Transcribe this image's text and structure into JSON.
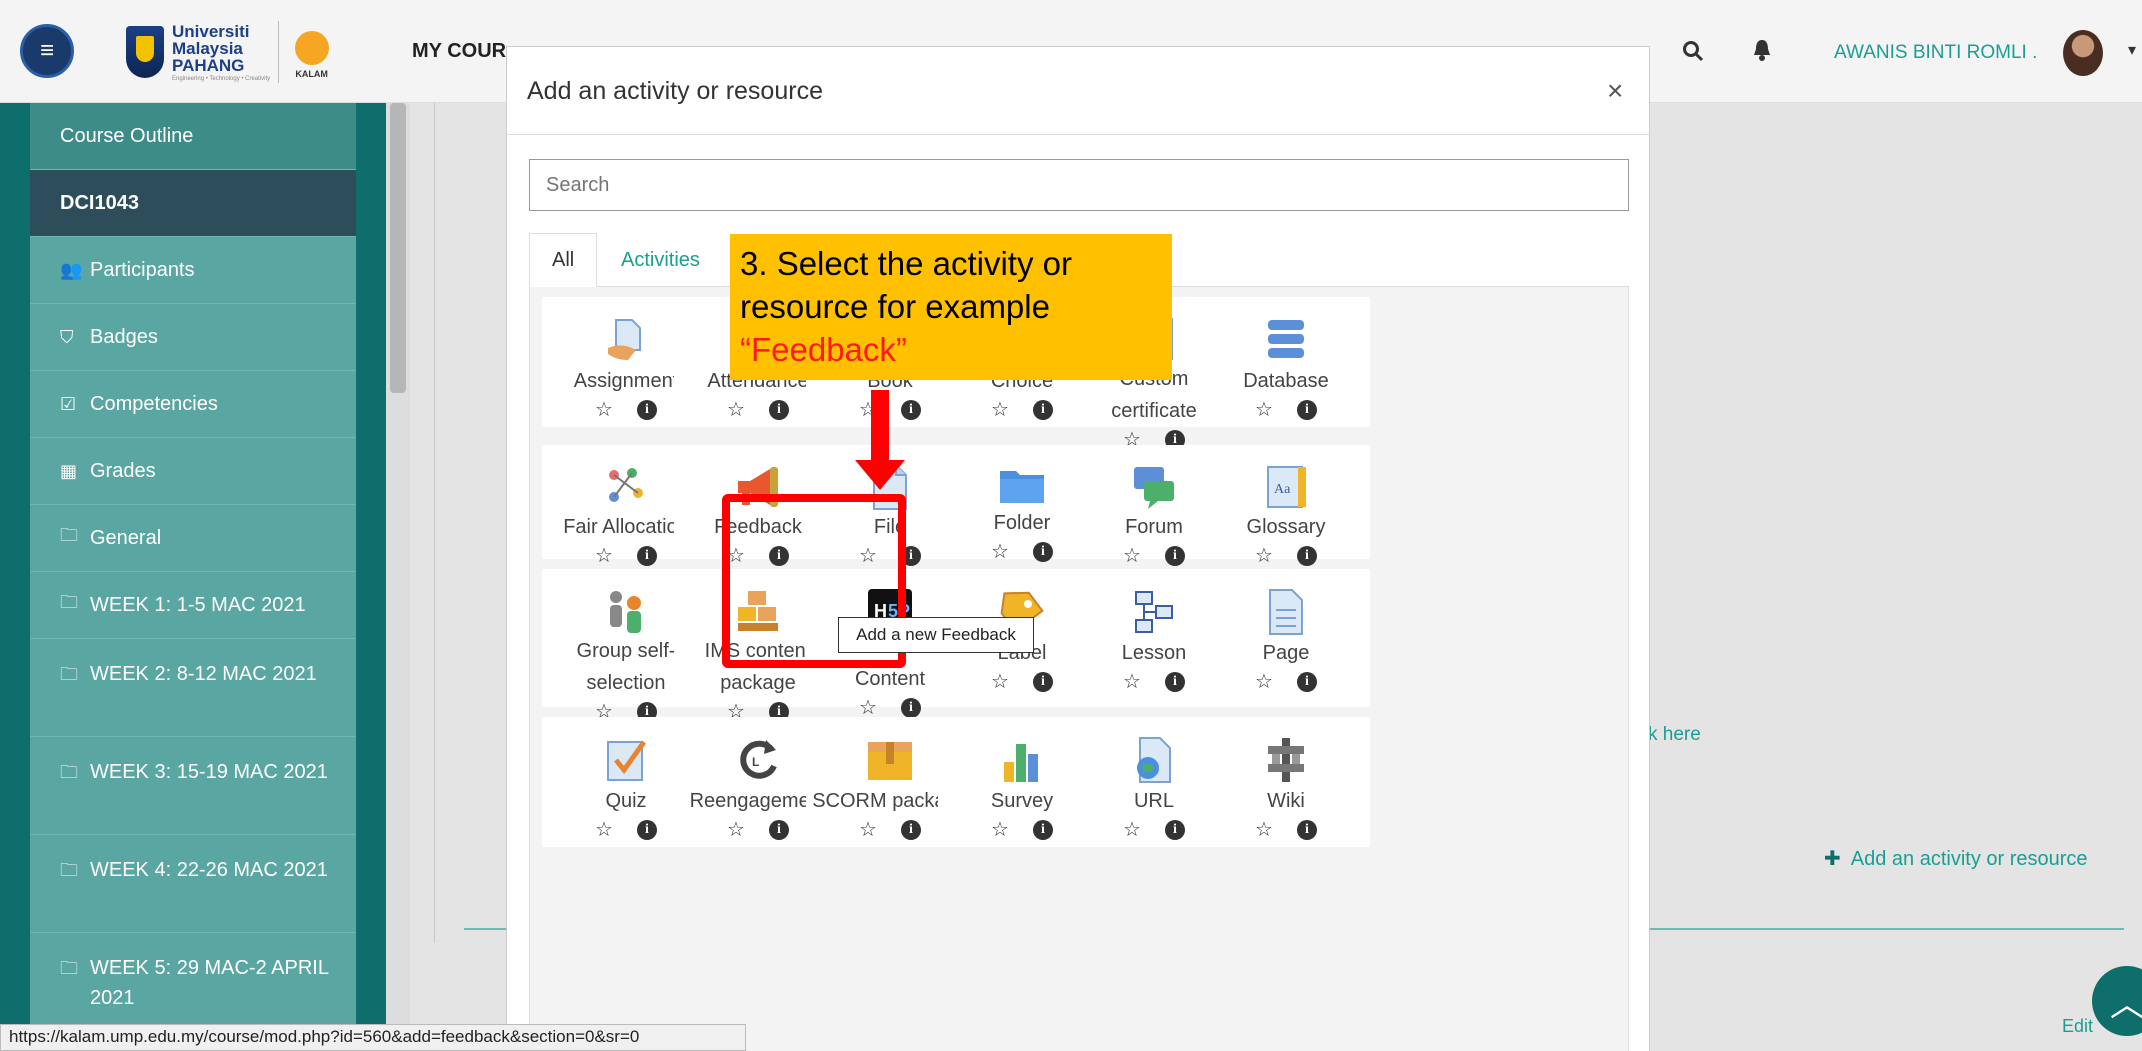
{
  "navbar": {
    "logo_name_1": "Universiti",
    "logo_name_2": "Malaysia",
    "logo_name_3": "PAHANG",
    "logo_tagline": "Engineering • Technology • Creativity",
    "logo_kalam": "KALAM",
    "my_courses": "MY COUR",
    "user_name": "AWANIS BINTI ROMLI ."
  },
  "sidebar": {
    "items": [
      {
        "label": "Course Outline",
        "icon": ""
      },
      {
        "label": "DCI1043",
        "icon": ""
      },
      {
        "label": "Participants",
        "icon": "users-icon"
      },
      {
        "label": "Badges",
        "icon": "shield-icon"
      },
      {
        "label": "Competencies",
        "icon": "check-square-icon"
      },
      {
        "label": "Grades",
        "icon": "table-icon"
      },
      {
        "label": "General",
        "icon": "folder-icon"
      },
      {
        "label": "WEEK 1: 1-5 MAC 2021",
        "icon": "folder-icon"
      },
      {
        "label": "WEEK 2: 8-12 MAC 2021",
        "icon": "folder-icon"
      },
      {
        "label": "WEEK 3: 15-19 MAC 2021",
        "icon": "folder-icon"
      },
      {
        "label": "WEEK 4: 22-26 MAC 2021",
        "icon": "folder-icon"
      },
      {
        "label": "WEEK 5: 29 MAC-2 APRIL 2021",
        "icon": "folder-icon"
      }
    ]
  },
  "page": {
    "click_here": "k here",
    "add_activity": "Add an activity or resource",
    "edit": "Edit"
  },
  "modal": {
    "title": "Add an activity or resource",
    "close": "×",
    "search_placeholder": "Search",
    "tabs": [
      "All",
      "Activities"
    ],
    "items": [
      "Assignment",
      "Attendance",
      "Book",
      "Choice",
      "Custom certificate",
      "Database",
      "Fair Allocation",
      "Feedback",
      "File",
      "Folder",
      "Forum",
      "Glossary",
      "Group self-selection",
      "IMS content package",
      "Interactive Content",
      "Label",
      "Lesson",
      "Page",
      "Quiz",
      "Reengagement",
      "SCORM package",
      "Survey",
      "URL",
      "Wiki"
    ],
    "tooltip": "Add a new Feedback"
  },
  "annotation": {
    "line1": "3. Select the activity or",
    "line2": "resource for example",
    "line3": "“Feedback”"
  },
  "statusbar": {
    "url": "https://kalam.ump.edu.my/course/mod.php?id=560&add=feedback&section=0&sr=0"
  },
  "icons": {
    "star": "☆",
    "info": "i",
    "hamburger": "≡",
    "search": "⚲",
    "bell": "🔔"
  },
  "colors": {
    "teal": "#1a9e94",
    "sidebar_teal": "#0d6e6b",
    "callout": "#ffc000",
    "highlight": "#ff0000"
  }
}
